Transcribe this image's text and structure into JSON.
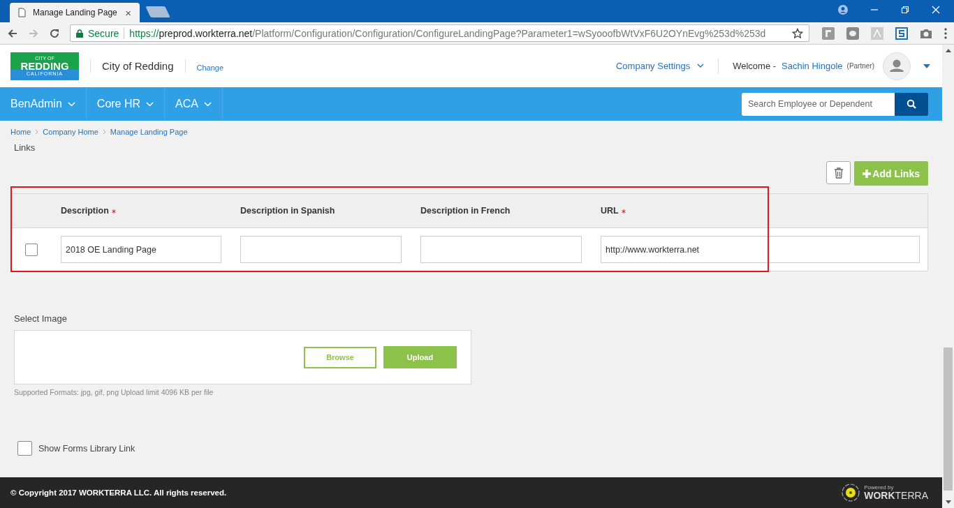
{
  "browser": {
    "tab": {
      "title": "Manage Landing Page",
      "close": "×"
    },
    "address": {
      "secure_label": "Secure",
      "scheme": "https://",
      "host": "preprod.workterra.net",
      "path": "/Platform/Configuration/Configuration/ConfigureLandingPage?Parameter1=wSyooofbWtVxF6U2OYnEvg%253d%253d"
    }
  },
  "header": {
    "logo": {
      "top": "CITY OF",
      "main": "REDDING",
      "bottom": "CALIFORNIA"
    },
    "company": "City of Redding",
    "change_link": "Change",
    "settings_menu": "Company Settings",
    "welcome": "Welcome -",
    "user_name": "Sachin Hingole",
    "user_role": "(Partner)"
  },
  "nav": {
    "items": [
      {
        "label": "BenAdmin"
      },
      {
        "label": "Core HR"
      },
      {
        "label": "ACA"
      }
    ],
    "search": {
      "placeholder": "Search Employee or Dependent"
    }
  },
  "breadcrumb": [
    "Home",
    "Company Home",
    "Manage Landing Page"
  ],
  "section_title": "Links",
  "add_button": "Add Links",
  "table": {
    "columns": [
      {
        "label": "Description",
        "required": true
      },
      {
        "label": "Description in Spanish",
        "required": false
      },
      {
        "label": "Description in French",
        "required": false
      },
      {
        "label": "URL",
        "required": true
      }
    ],
    "rows": [
      {
        "checked": false,
        "cells": [
          "2018 OE Landing Page",
          null,
          null,
          "http://www.workterra.net"
        ]
      }
    ]
  },
  "select_image": {
    "label": "Select Image",
    "browse": "Browse",
    "upload": "Upload",
    "hint": "Supported Formats: jpg, gif, png Upload limit 4096 KB per file"
  },
  "forms_library": {
    "label": "Show Forms Library Link",
    "checked": false
  },
  "footer": {
    "copyright": "© Copyright 2017 WORKTERRA LLC. All rights reserved.",
    "powered_by": "Powered by",
    "brand_bold": "WORK",
    "brand_light": "TERRA"
  }
}
